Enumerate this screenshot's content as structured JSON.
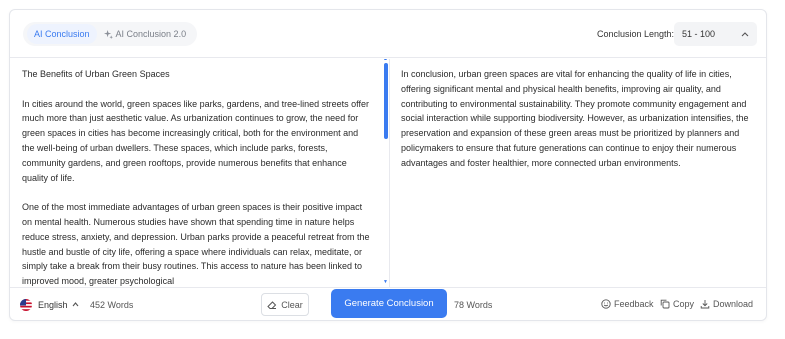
{
  "tabs": [
    {
      "label": "AI Conclusion",
      "active": true
    },
    {
      "label": "AI Conclusion 2.0",
      "active": false
    }
  ],
  "length": {
    "label": "Conclusion Length:",
    "value": "51 - 100"
  },
  "source": {
    "paragraphs": [
      "The Benefits of Urban Green Spaces",
      "In cities around the world, green spaces like parks, gardens, and tree-lined streets offer much more than just aesthetic value. As urbanization continues to grow, the need for green spaces in cities has become increasingly critical, both for the environment and the well-being of urban dwellers. These spaces, which include parks, forests, community gardens, and green rooftops, provide numerous benefits that enhance quality of life.",
      "One of the most immediate advantages of urban green spaces is their positive impact on mental health. Numerous studies have shown that spending time in nature helps reduce stress, anxiety, and depression. Urban parks provide a peaceful retreat from the hustle and bustle of city life, offering a space where individuals can relax, meditate, or simply take a break from their busy routines. This access to nature has been linked to improved mood, greater psychological"
    ]
  },
  "output": {
    "text": "In conclusion, urban green spaces are vital for enhancing the quality of life in cities, offering significant mental and physical health benefits, improving air quality, and contributing to environmental sustainability. They promote community engagement and social interaction while supporting biodiversity. However, as urbanization intensifies, the preservation and expansion of these green areas must be prioritized by planners and policymakers to ensure that future generations can continue to enjoy their numerous advantages and foster healthier, more connected urban environments."
  },
  "footer": {
    "language": "English",
    "source_words": "452 Words",
    "clear_label": "Clear",
    "generate_label": "Generate Conclusion",
    "output_words": "78 Words",
    "feedback_label": "Feedback",
    "copy_label": "Copy",
    "download_label": "Download"
  },
  "colors": {
    "accent": "#3a7bf0",
    "border": "#e4e6eb"
  }
}
